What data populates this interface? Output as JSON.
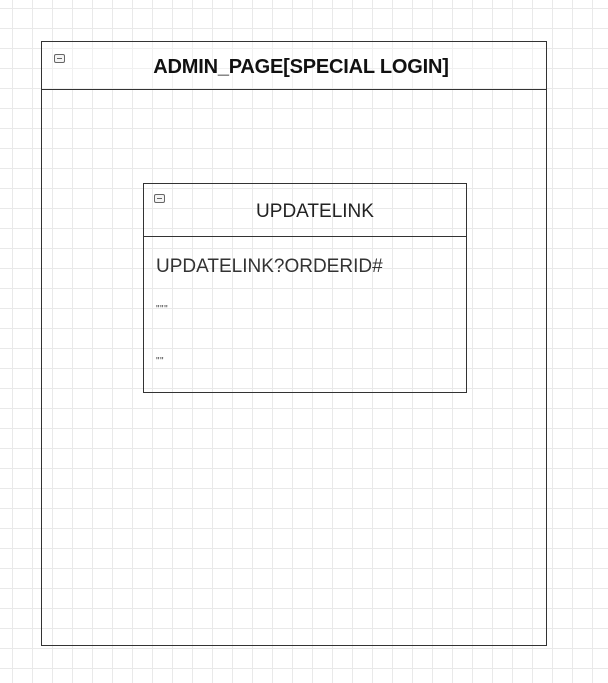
{
  "diagram": {
    "container": {
      "title": "ADMIN_PAGE[SPECIAL LOGIN]",
      "icon": "collapse-icon"
    },
    "class_box": {
      "title": "UPDATELINK",
      "icon": "collapse-icon",
      "attributes": [
        "UPDATELINK?ORDERID#",
        "\"\"\"",
        "\"\""
      ]
    },
    "colors": {
      "border": "#333333",
      "grid": "#e9e9e9",
      "background": "#ffffff"
    }
  }
}
